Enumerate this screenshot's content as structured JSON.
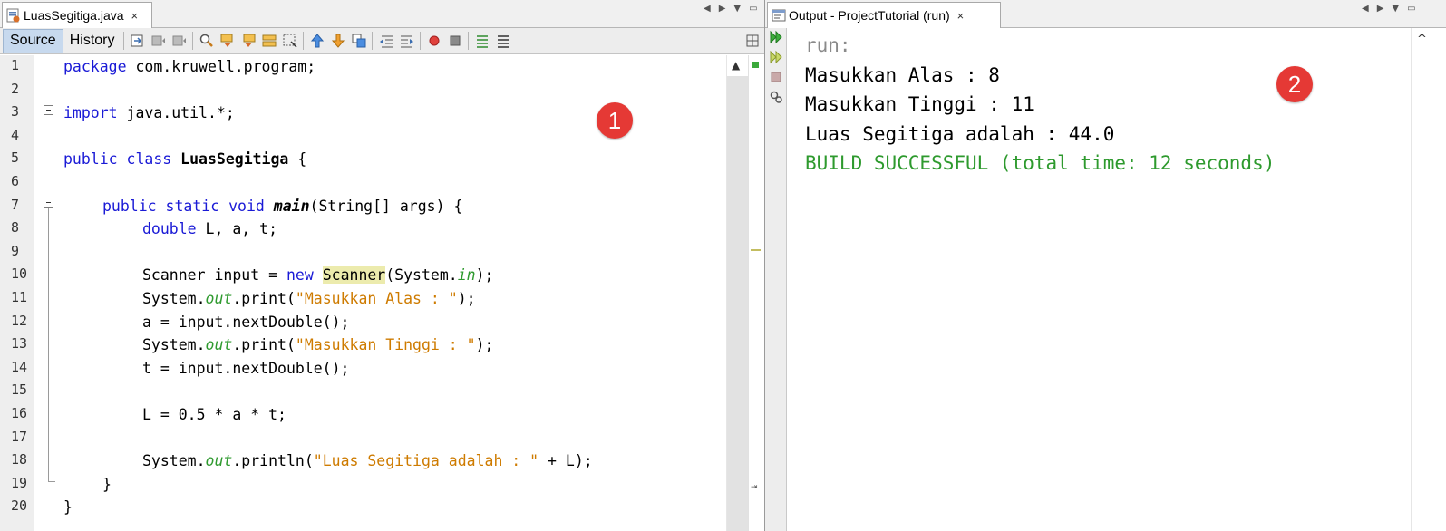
{
  "editor": {
    "tab_title": "LuasSegitiga.java",
    "tab_close": "×",
    "toolbar": {
      "source_label": "Source",
      "history_label": "History"
    },
    "line_numbers": [
      "1",
      "2",
      "3",
      "4",
      "5",
      "6",
      "7",
      "8",
      "9",
      "10",
      "11",
      "12",
      "13",
      "14",
      "15",
      "16",
      "17",
      "18",
      "19",
      "20"
    ],
    "code": {
      "l1_kw": "package",
      "l1_rest": " com.kruwell.program;",
      "l3_kw": "import",
      "l3_rest": " java.util.*;",
      "l5_kw1": "public",
      "l5_kw2": "class",
      "l5_name": "LuasSegitiga",
      "l5_rest": " {",
      "l7_kw1": "public",
      "l7_kw2": "static",
      "l7_kw3": "void",
      "l7_name": "main",
      "l7_rest": "(String[] args) {",
      "l8_kw": "double",
      "l8_rest": " L, a, t;",
      "l10_a": "Scanner input = ",
      "l10_kw": "new",
      "l10_hl": "Scanner",
      "l10_b": "(System.",
      "l10_it": "in",
      "l10_c": ");",
      "l11_a": "System.",
      "l11_it": "out",
      "l11_b": ".print(",
      "l11_str": "\"Masukkan Alas : \"",
      "l11_c": ");",
      "l12": "a = input.nextDouble();",
      "l13_a": "System.",
      "l13_it": "out",
      "l13_b": ".print(",
      "l13_str": "\"Masukkan Tinggi : \"",
      "l13_c": ");",
      "l14": "t = input.nextDouble();",
      "l16": "L = 0.5 * a * t;",
      "l18_a": "System.",
      "l18_it": "out",
      "l18_b": ".println(",
      "l18_str": "\"Luas Segitiga adalah : \"",
      "l18_c": " + L);",
      "l19": "}",
      "l20": "}"
    },
    "badge": "1"
  },
  "output": {
    "tab_title": "Output - ProjectTutorial (run)",
    "tab_close": "×",
    "lines": {
      "run": "run:",
      "alas": "Masukkan Alas : 8",
      "tinggi": "Masukkan Tinggi : 11",
      "luas": "Luas Segitiga adalah : 44.0",
      "build": "BUILD SUCCESSFUL (total time: 12 seconds)"
    },
    "badge": "2"
  },
  "colors": {
    "keyword": "#1a1ad6",
    "string": "#ce7b00",
    "static_field": "#2f9a2f",
    "build_success": "#2e9a2e",
    "run_text": "#8a8a8a",
    "badge": "#e53935"
  }
}
